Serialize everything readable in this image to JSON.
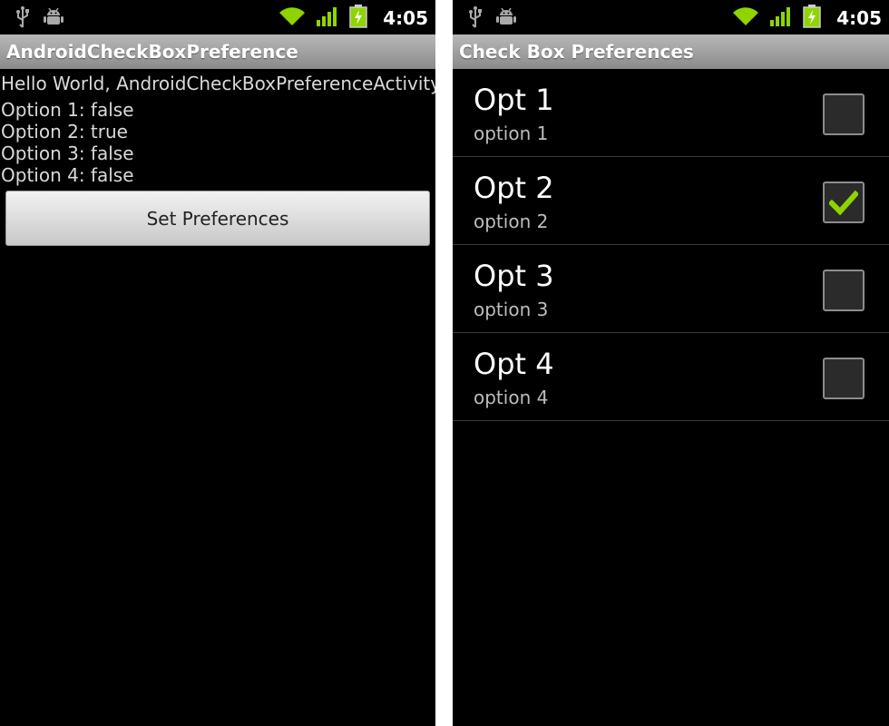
{
  "left_screen": {
    "status_bar": {
      "time": "4:05",
      "icons": [
        "usb-icon",
        "android-debug-icon",
        "wifi-icon",
        "signal-icon",
        "battery-charging-icon"
      ]
    },
    "title": "AndroidCheckBoxPreference",
    "hello_text": "Hello World, AndroidCheckBoxPreferenceActivity!",
    "options": [
      {
        "text": "Option 1: false"
      },
      {
        "text": "Option 2: true"
      },
      {
        "text": "Option 3: false"
      },
      {
        "text": "Option 4: false"
      }
    ],
    "button_label": "Set Preferences"
  },
  "right_screen": {
    "status_bar": {
      "time": "4:05",
      "icons": [
        "usb-icon",
        "android-debug-icon",
        "wifi-icon",
        "signal-icon",
        "battery-charging-icon"
      ]
    },
    "title": "Check Box Preferences",
    "preferences": [
      {
        "title": "Opt 1",
        "summary": "option 1",
        "checked": false
      },
      {
        "title": "Opt 2",
        "summary": "option 2",
        "checked": true
      },
      {
        "title": "Opt 3",
        "summary": "option 3",
        "checked": false
      },
      {
        "title": "Opt 4",
        "summary": "option 4",
        "checked": false
      }
    ]
  },
  "colors": {
    "accent_green": "#8fd400",
    "titlebar_gray": "#a0a0a0",
    "background": "#000000"
  }
}
